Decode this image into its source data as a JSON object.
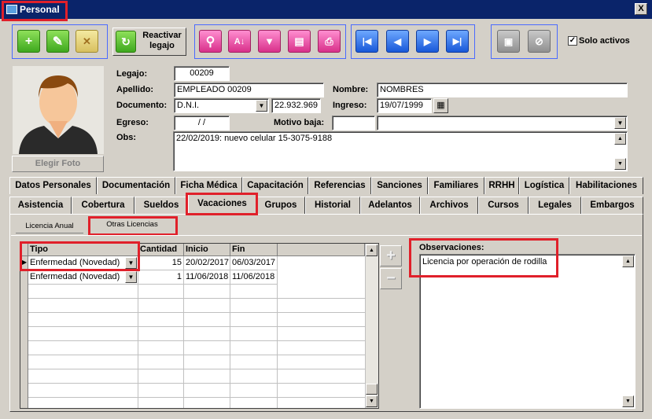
{
  "window": {
    "title": "Personal",
    "close": "X"
  },
  "toolbar": {
    "reactivar": "Reactivar legajo",
    "solo_activos": "Solo activos"
  },
  "photo": {
    "button": "Elegir Foto"
  },
  "form": {
    "legajo_label": "Legajo:",
    "legajo": "00209",
    "apellido_label": "Apellido:",
    "apellido": "EMPLEADO 00209",
    "nombre_label": "Nombre:",
    "nombre": "NOMBRES",
    "documento_label": "Documento:",
    "doc_tipo": "D.N.I.",
    "doc_num": "22.932.969",
    "ingreso_label": "Ingreso:",
    "ingreso": "19/07/1999",
    "egreso_label": "Egreso:",
    "egreso": "/ /",
    "motivo_label": "Motivo baja:",
    "obs_label": "Obs:",
    "obs": "22/02/2019: nuevo celular 15-3075-9188"
  },
  "tabs_row1": [
    "Datos Personales",
    "Documentación",
    "Ficha Médica",
    "Capacitación",
    "Referencias",
    "Sanciones",
    "Familiares",
    "RRHH",
    "Logística",
    "Habilitaciones"
  ],
  "tabs_row2": [
    "Asistencia",
    "Cobertura",
    "Sueldos",
    "Vacaciones",
    "Grupos",
    "Historial",
    "Adelantos",
    "Archivos",
    "Cursos",
    "Legales",
    "Embargos"
  ],
  "subtabs": [
    "Licencia Anual",
    "Otras Licencias"
  ],
  "grid": {
    "headers": [
      "Tipo",
      "Cantidad",
      "Inicio",
      "Fin"
    ],
    "rows": [
      [
        "Enfermedad (Novedad)",
        "15",
        "20/02/2017",
        "06/03/2017"
      ],
      [
        "Enfermedad (Novedad)",
        "1",
        "11/06/2018",
        "11/06/2018"
      ]
    ]
  },
  "observaciones": {
    "label": "Observaciones:",
    "text": "Licencia por operación de rodilla"
  },
  "colors": {
    "titlebar": "#0a246a",
    "highlight": "#e0202a",
    "face": "#d4d0c8"
  }
}
